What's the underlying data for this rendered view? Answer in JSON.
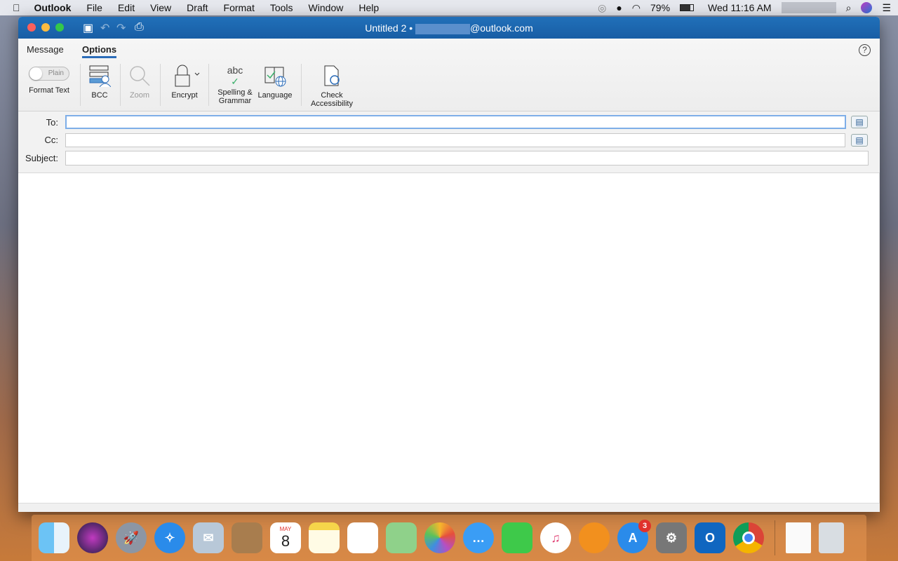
{
  "menubar": {
    "app": "Outlook",
    "items": [
      "File",
      "Edit",
      "View",
      "Draft",
      "Format",
      "Tools",
      "Window",
      "Help"
    ],
    "battery": "79%",
    "clock": "Wed 11:16 AM"
  },
  "window": {
    "title_prefix": "Untitled 2 •",
    "title_suffix": "@outlook.com"
  },
  "ribbon": {
    "tabs": [
      "Message",
      "Options"
    ],
    "active_tab": "Options",
    "format_toggle": "Plain",
    "format_label": "Format Text",
    "bcc": "BCC",
    "zoom": "Zoom",
    "encrypt": "Encrypt",
    "spelling_icon_text": "abc",
    "spelling": "Spelling &",
    "spelling2": "Grammar",
    "language": "Language",
    "check": "Check",
    "check2": "Accessibility",
    "help": "?"
  },
  "fields": {
    "to_label": "To:",
    "cc_label": "Cc:",
    "subject_label": "Subject:",
    "to": "",
    "cc": "",
    "subject": ""
  },
  "dock": {
    "calendar_month": "MAY",
    "calendar_day": "8",
    "appstore_badge": "3",
    "apps": [
      "finder",
      "siri",
      "launchpad",
      "safari",
      "mail",
      "contacts",
      "calendar",
      "notes",
      "reminders",
      "maps",
      "photos",
      "messages",
      "facetime",
      "itunes",
      "ibooks",
      "app-store",
      "system-preferences",
      "outlook",
      "chrome"
    ]
  },
  "colors": {
    "titlebar": "#1d67b0",
    "accent": "#2b6cb8"
  }
}
